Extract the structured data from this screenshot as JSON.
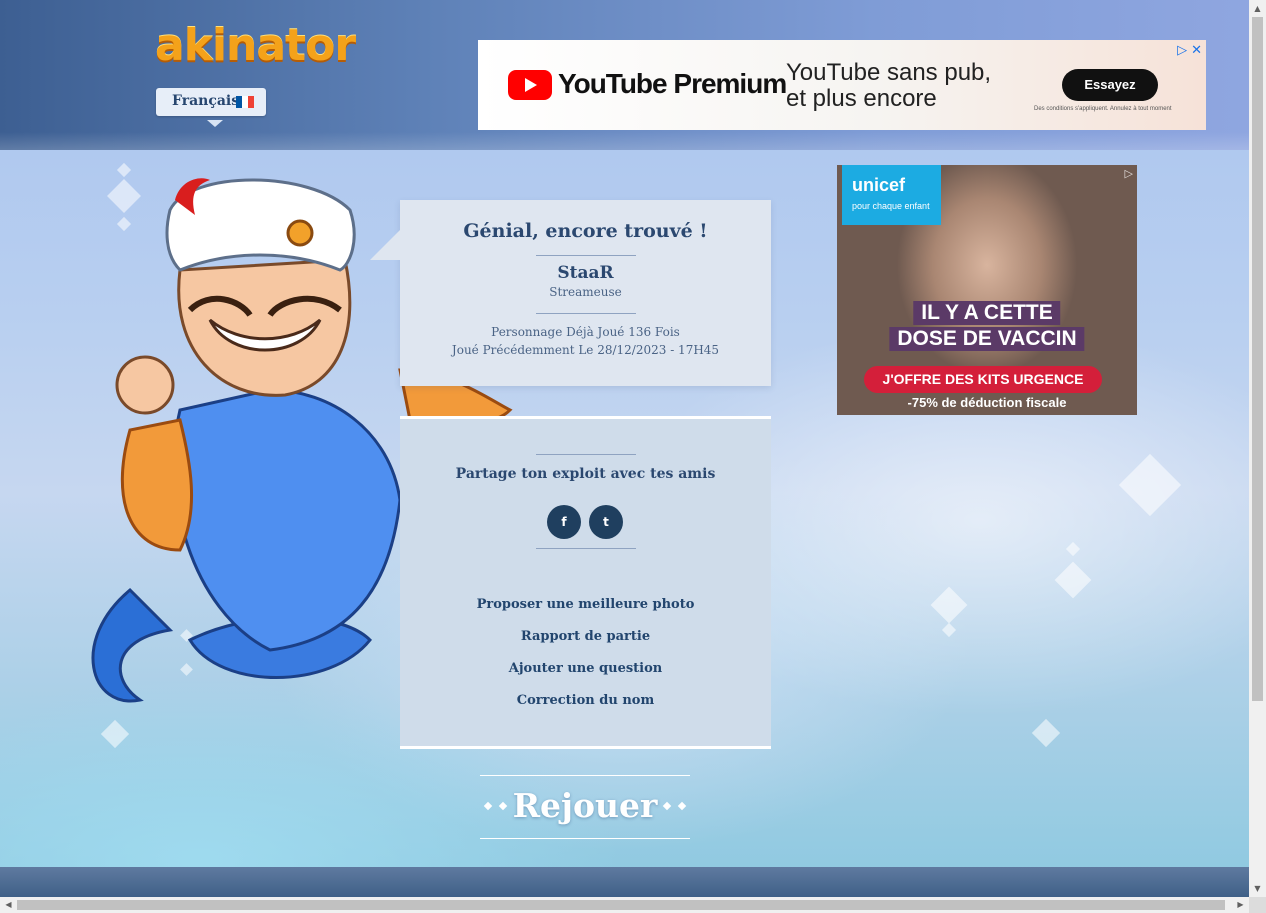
{
  "header": {
    "logo_text": "akinator",
    "language": "Français",
    "flag_colors": [
      "#0055a4",
      "#ffffff",
      "#ef4135"
    ]
  },
  "ad_top": {
    "brand": "YouTube Premium",
    "tagline_line1": "YouTube sans pub,",
    "tagline_line2": "et plus encore",
    "cta": "Essayez",
    "fineprint": "Des conditions s'appliquent. Annulez à tout moment",
    "adchoices_icon": "play-triangle-icon",
    "close_icon": "close-icon"
  },
  "ad_right": {
    "org": "unicef",
    "org_sub": "pour chaque enfant",
    "headline_line1": "IL Y A CETTE",
    "headline_line2": "DOSE DE VACCIN",
    "cta": "J'OFFRE DES KITS URGENCE",
    "deduction": "-75% de déduction fiscale"
  },
  "result": {
    "title": "Génial, encore trouvé !",
    "character_name": "StaaR",
    "character_desc": "Streameuse",
    "played_count": "Personnage Déjà Joué 136 Fois",
    "last_played": "Joué Précédemment Le 28/12/2023 - 17H45"
  },
  "share": {
    "title": "Partage ton exploit avec tes amis",
    "facebook_icon": "f",
    "twitter_icon": "t"
  },
  "links": {
    "better_photo": "Proposer une meilleure photo",
    "game_report": "Rapport de partie",
    "add_question": "Ajouter une question",
    "fix_name": "Correction du nom"
  },
  "replay": {
    "label": "Rejouer"
  },
  "colors": {
    "header_dark": "#3d5f92",
    "card_text": "#2b4870",
    "social_btn": "#1f3f5f",
    "logo_orange": "#f4a21a"
  }
}
